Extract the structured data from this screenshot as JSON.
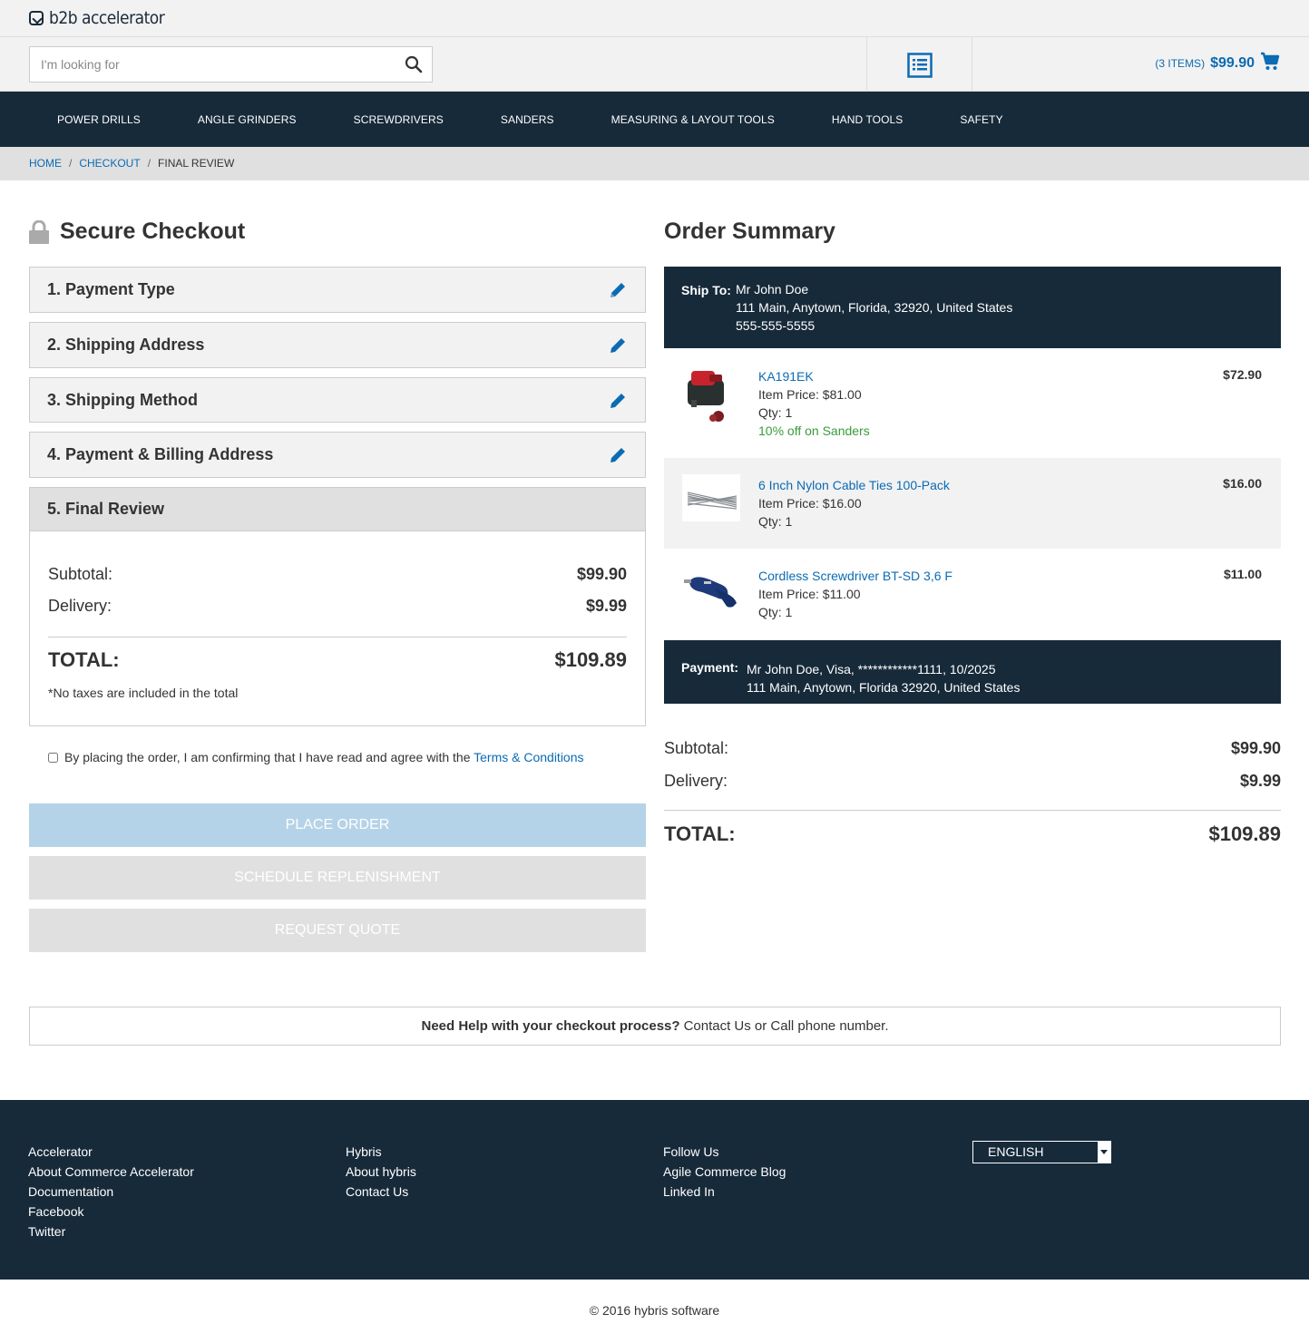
{
  "header": {
    "logo_text": "b2b accelerator",
    "search_placeholder": "I'm looking for",
    "cart_items": "(3 ITEMS)",
    "cart_total": "$99.90"
  },
  "nav": [
    "POWER DRILLS",
    "ANGLE GRINDERS",
    "SCREWDRIVERS",
    "SANDERS",
    "MEASURING & LAYOUT TOOLS",
    "HAND TOOLS",
    "SAFETY"
  ],
  "breadcrumb": {
    "home": "HOME",
    "checkout": "CHECKOUT",
    "current": "FINAL REVIEW",
    "sep": "/"
  },
  "checkout": {
    "title": "Secure Checkout",
    "steps": [
      "1. Payment Type",
      "2. Shipping Address",
      "3. Shipping Method",
      "4. Payment & Billing Address",
      "5. Final Review"
    ],
    "subtotal_label": "Subtotal:",
    "subtotal": "$99.90",
    "delivery_label": "Delivery:",
    "delivery": "$9.99",
    "total_label": "TOTAL:",
    "total": "$109.89",
    "note": "*No taxes are included in the total",
    "terms_text": "By placing the order, I am confirming that I have read and agree with the",
    "terms_link": "Terms & Conditions",
    "place_order": "PLACE ORDER",
    "schedule": "SCHEDULE REPLENISHMENT",
    "quote": "REQUEST QUOTE"
  },
  "summary": {
    "title": "Order Summary",
    "ship_label": "Ship To:",
    "ship_name": "Mr John Doe",
    "ship_address": "111 Main,  Anytown,  Florida,  32920,  United States",
    "ship_phone": "555-555-5555",
    "items": [
      {
        "name": "KA191EK",
        "item_price": "Item Price:  $81.00",
        "qty": "Qty: 1",
        "promo": "10% off on Sanders",
        "price": "$72.90"
      },
      {
        "name": "6 Inch Nylon Cable Ties 100-Pack",
        "item_price": "Item Price:  $16.00",
        "qty": "Qty: 1",
        "price": "$16.00"
      },
      {
        "name": "Cordless Screwdriver BT-SD 3,6 F",
        "item_price": "Item Price:  $11.00",
        "qty": "Qty: 1",
        "price": "$11.00"
      }
    ],
    "payment_label": "Payment:",
    "payment_line1": "Mr John Doe, Visa, ************1111, 10/2025",
    "payment_line2": "111 Main, Anytown, Florida 32920, United States",
    "subtotal_label": "Subtotal:",
    "subtotal": "$99.90",
    "delivery_label": "Delivery:",
    "delivery": "$9.99",
    "total_label": "TOTAL:",
    "total": "$109.89"
  },
  "help": {
    "bold": "Need Help with your checkout process?",
    "text": "Contact Us or Call phone number."
  },
  "footer": {
    "col1": [
      "Accelerator",
      "About Commerce Accelerator",
      "Documentation",
      "Facebook",
      "Twitter"
    ],
    "col2": [
      "Hybris",
      "About hybris",
      "Contact Us"
    ],
    "col3": [
      "Follow Us",
      "Agile Commerce Blog",
      "Linked In"
    ],
    "language": "ENGLISH",
    "copyright": "© 2016 hybris software"
  },
  "colors": {
    "navy": "#172a3a",
    "link": "#0b6bb3",
    "promo": "#3a9b3a",
    "place_order_bg": "#b5d3e8",
    "disabled_bg": "#e0e0e0"
  }
}
